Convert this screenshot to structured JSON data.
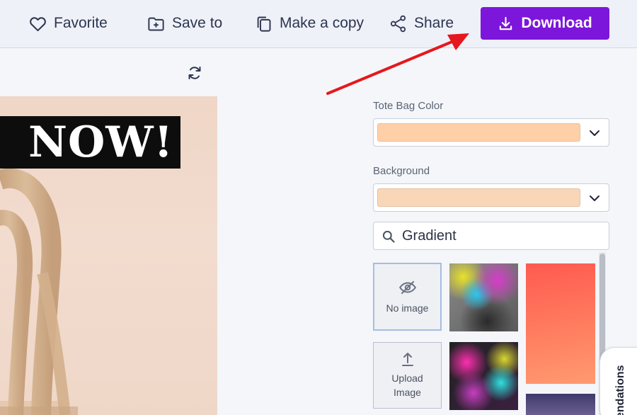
{
  "toolbar": {
    "favorite_label": "Favorite",
    "save_label": "Save to",
    "copy_label": "Make a copy",
    "share_label": "Share",
    "download_label": "Download"
  },
  "canvas": {
    "headline": "NOW!"
  },
  "panel": {
    "tote_color_label": "Tote Bag Color",
    "tote_color_value": "#ffcfa8",
    "background_label": "Background",
    "background_value": "#fad6b8",
    "search_value": "Gradient",
    "no_image_label": "No image",
    "upload_label_1": "Upload",
    "upload_label_2": "Image",
    "recommendations_label": "endations"
  },
  "colors": {
    "accent": "#7d16db",
    "annotation_arrow": "#e5181d"
  }
}
